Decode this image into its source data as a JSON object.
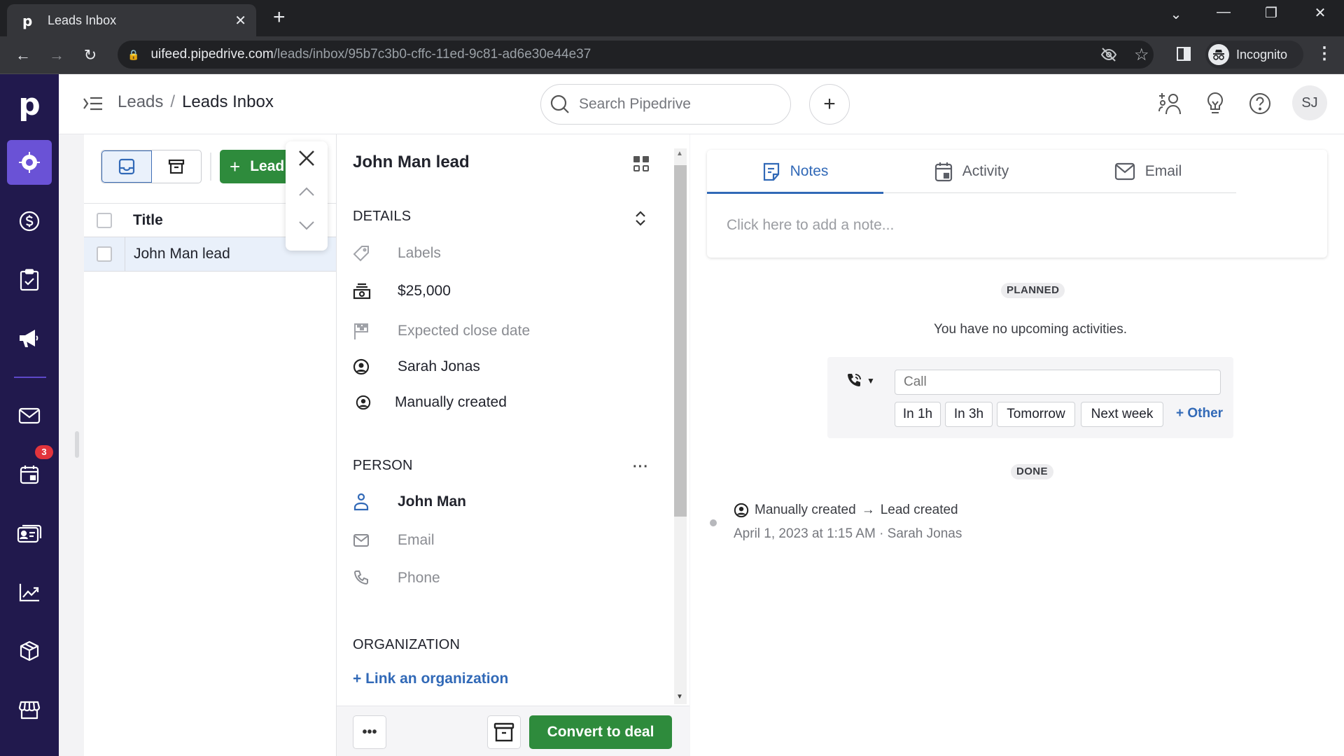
{
  "browser": {
    "tab_title": "Leads Inbox",
    "favicon": "p",
    "url_domain": "uifeed.pipedrive.com",
    "url_path": "/leads/inbox/95b7c3b0-cffc-11ed-9c81-ad6e30e44e37",
    "profile_label": "Incognito"
  },
  "sidebar": {
    "logo": "p",
    "items": [
      {
        "name": "leads",
        "icon": "target-icon",
        "active": true
      },
      {
        "name": "deals",
        "icon": "dollar-icon"
      },
      {
        "name": "activities",
        "icon": "clipboard-check-icon"
      },
      {
        "name": "campaigns",
        "icon": "megaphone-icon"
      },
      {
        "name": "mail",
        "icon": "envelope-icon"
      },
      {
        "name": "calendar",
        "icon": "calendar-icon",
        "badge": "3"
      },
      {
        "name": "contacts",
        "icon": "contact-cards-icon"
      },
      {
        "name": "insights",
        "icon": "trend-chart-icon"
      },
      {
        "name": "products",
        "icon": "box-icon"
      },
      {
        "name": "marketplace",
        "icon": "store-icon"
      }
    ]
  },
  "header": {
    "breadcrumb": [
      "Leads",
      "Leads Inbox"
    ],
    "breadcrumb_sep": "/",
    "search_placeholder": "Search Pipedrive",
    "add_label": "+",
    "avatar_initials": "SJ"
  },
  "list": {
    "add_lead_label": "Lead",
    "columns": [
      "Title"
    ],
    "rows": [
      {
        "title": "John Man lead",
        "selected": true
      }
    ]
  },
  "detail": {
    "title": "John Man lead",
    "details_heading": "DETAILS",
    "labels_placeholder": "Labels",
    "value": "$25,000",
    "expected_close_placeholder": "Expected close date",
    "owner": "Sarah Jonas",
    "source": "Manually created",
    "person_heading": "PERSON",
    "person_name": "John Man",
    "email_placeholder": "Email",
    "phone_placeholder": "Phone",
    "organization_heading": "ORGANIZATION",
    "link_org_label": "+ Link an organization",
    "more_label": "•••",
    "convert_label": "Convert to deal"
  },
  "activity_panel": {
    "tabs": [
      {
        "label": "Notes",
        "active": true
      },
      {
        "label": "Activity"
      },
      {
        "label": "Email"
      }
    ],
    "note_placeholder": "Click here to add a note...",
    "planned_label": "PLANNED",
    "no_upcoming": "You have no upcoming activities.",
    "activity_input_placeholder": "Call",
    "quick_buttons": [
      "In 1h",
      "In 3h",
      "Tomorrow",
      "Next week"
    ],
    "other_label": "+ Other",
    "done_label": "DONE",
    "history": [
      {
        "text_from": "Manually created",
        "arrow": "→",
        "text_to": "Lead created",
        "meta": "April 1, 2023 at 1:15 AM · Sarah Jonas"
      }
    ]
  },
  "colors": {
    "sidebar_bg": "#21194d",
    "sidebar_active": "#6a52d6",
    "primary_green": "#2e8b3c",
    "link_blue": "#3169b7",
    "badge_red": "#e2343c"
  }
}
